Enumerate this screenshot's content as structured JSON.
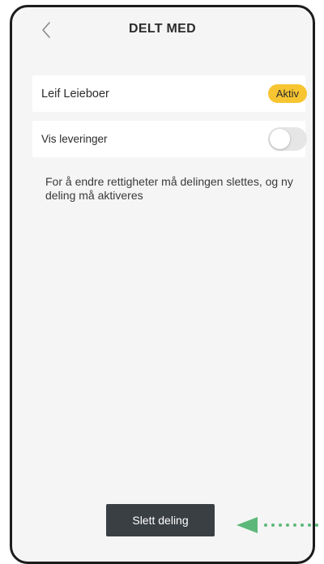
{
  "header": {
    "back_icon": "chevron-left-icon",
    "title": "DELT MED"
  },
  "shared_user": {
    "name": "Leif Leieboer",
    "status": "Aktiv",
    "status_color": "#f7c531"
  },
  "deliveries": {
    "label": "Vis leveringer",
    "enabled": false
  },
  "info": {
    "text": "For å endre rettigheter må delingen slettes, og ny deling må aktiveres"
  },
  "actions": {
    "delete_label": "Slett deling",
    "delete_color": "#3a3f44"
  },
  "annotation": {
    "arrow_icon": "dotted-arrow-left-icon",
    "arrow_color": "#5cb87a"
  }
}
